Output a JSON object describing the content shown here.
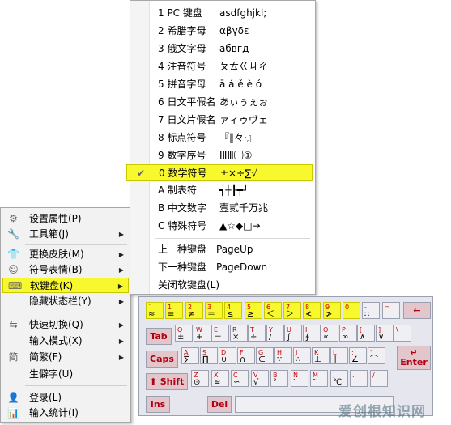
{
  "context_menu": {
    "items": [
      {
        "label": "设置属性(P)",
        "icon": "gear-icon",
        "glyph": "⚙",
        "arrow": false
      },
      {
        "label": "工具箱(J)",
        "icon": "wrench-icon",
        "glyph": "🔧",
        "arrow": true
      },
      {
        "label": "更换皮肤(M)",
        "icon": "shirt-icon",
        "glyph": "👕",
        "arrow": true
      },
      {
        "label": "符号表情(B)",
        "icon": "smiley-icon",
        "glyph": "☺",
        "arrow": true
      },
      {
        "label": "软键盘(K)",
        "icon": "keyboard-icon",
        "glyph": "⌨",
        "arrow": true,
        "highlighted": true
      },
      {
        "label": "隐藏状态栏(Y)",
        "icon": "",
        "glyph": "",
        "arrow": true
      },
      {
        "label": "快速切换(Q)",
        "icon": "switch-icon",
        "glyph": "⇆",
        "arrow": true
      },
      {
        "label": "输入模式(X)",
        "icon": "",
        "glyph": "",
        "arrow": true
      },
      {
        "label": "简繁(F)",
        "icon": "simplified-icon",
        "glyph": "简",
        "arrow": true
      },
      {
        "label": "生僻字(U)",
        "icon": "",
        "glyph": "",
        "arrow": false
      },
      {
        "label": "登录(L)",
        "icon": "user-icon",
        "glyph": "👤",
        "arrow": false
      },
      {
        "label": "输入统计(I)",
        "icon": "stats-icon",
        "glyph": "📊",
        "arrow": false
      }
    ]
  },
  "submenu": {
    "items": [
      {
        "label": "1 PC 键盘",
        "sample": "asdfghjkl;"
      },
      {
        "label": "2 希腊字母",
        "sample": "αβγδε"
      },
      {
        "label": "3 俄文字母",
        "sample": "абвгд"
      },
      {
        "label": "4 注音符号",
        "sample": "ㄆㄊㄍㄐㄔ"
      },
      {
        "label": "5 拼音字母",
        "sample": "ā á ě è ó"
      },
      {
        "label": "6 日文平假名",
        "sample": "あぃぅぇぉ"
      },
      {
        "label": "7 日文片假名",
        "sample": "ァィゥヴェ"
      },
      {
        "label": "8 标点符号",
        "sample": "『‖々·』"
      },
      {
        "label": "9 数字序号",
        "sample": "ⅠⅡⅢ㈠①"
      },
      {
        "label": "0 数学符号",
        "sample": "±×÷∑√",
        "checked": true
      },
      {
        "label": "A 制表符",
        "sample": "┑┼┠┯┘"
      },
      {
        "label": "B 中文数字",
        "sample": "壹贰千万兆"
      },
      {
        "label": "C 特殊符号",
        "sample": "▲☆◆□→"
      },
      {
        "label": "上一种键盘",
        "sample": "PageUp"
      },
      {
        "label": "下一种键盘",
        "sample": "PageDown"
      },
      {
        "label": "关闭软键盘(L)",
        "sample": ""
      }
    ]
  },
  "keyboard": {
    "row1": [
      {
        "t": "`",
        "b": "≈"
      },
      {
        "t": "1",
        "b": "≡"
      },
      {
        "t": "2",
        "b": "≠"
      },
      {
        "t": "3",
        "b": "＝"
      },
      {
        "t": "4",
        "b": "≤"
      },
      {
        "t": "5",
        "b": "≥"
      },
      {
        "t": "6",
        "b": "＜"
      },
      {
        "t": "7",
        "b": "＞"
      },
      {
        "t": "8",
        "b": "≮"
      },
      {
        "t": "9",
        "b": "≯"
      },
      {
        "t": "0",
        "b": ""
      },
      {
        "t": "-",
        "b": "∷"
      },
      {
        "t": "=",
        "b": ""
      }
    ],
    "row2": [
      {
        "t": "Q",
        "b": "±"
      },
      {
        "t": "W",
        "b": "+"
      },
      {
        "t": "E",
        "b": "－"
      },
      {
        "t": "R",
        "b": "×"
      },
      {
        "t": "T",
        "b": "÷"
      },
      {
        "t": "Y",
        "b": "/"
      },
      {
        "t": "U",
        "b": "∫"
      },
      {
        "t": "I",
        "b": "∮"
      },
      {
        "t": "O",
        "b": "∝"
      },
      {
        "t": "P",
        "b": "∞"
      },
      {
        "t": "[",
        "b": "∧"
      },
      {
        "t": "]",
        "b": "∨"
      },
      {
        "t": "\\",
        "b": ""
      }
    ],
    "row3": [
      {
        "t": "A",
        "b": "∑"
      },
      {
        "t": "S",
        "b": "∏"
      },
      {
        "t": "D",
        "b": "∪"
      },
      {
        "t": "F",
        "b": "∩"
      },
      {
        "t": "G",
        "b": "∈"
      },
      {
        "t": "H",
        "b": "∵"
      },
      {
        "t": "J",
        "b": "∴"
      },
      {
        "t": "K",
        "b": "⊥"
      },
      {
        "t": "L",
        "b": "∥"
      },
      {
        "t": ";",
        "b": "∠"
      },
      {
        "t": "'",
        "b": "⌒"
      }
    ],
    "row4": [
      {
        "t": "Z",
        "b": "⊙"
      },
      {
        "t": "X",
        "b": "≌"
      },
      {
        "t": "C",
        "b": "∽"
      },
      {
        "t": "V",
        "b": "√"
      },
      {
        "t": "B",
        "b": "°"
      },
      {
        "t": "N",
        "b": "′"
      },
      {
        "t": "M",
        "b": "″"
      },
      {
        "t": ",",
        "b": "℃"
      },
      {
        "t": ".",
        "b": ""
      },
      {
        "t": "/",
        "b": ""
      }
    ],
    "fn": {
      "backspace": "←",
      "tab": "Tab",
      "caps": "Caps",
      "enter": "Enter",
      "enter_arrow": "↵",
      "shift": "Shift",
      "shift_arrow": "⬆",
      "ins": "Ins",
      "del": "Del"
    }
  },
  "watermark": "爱创根知识网"
}
